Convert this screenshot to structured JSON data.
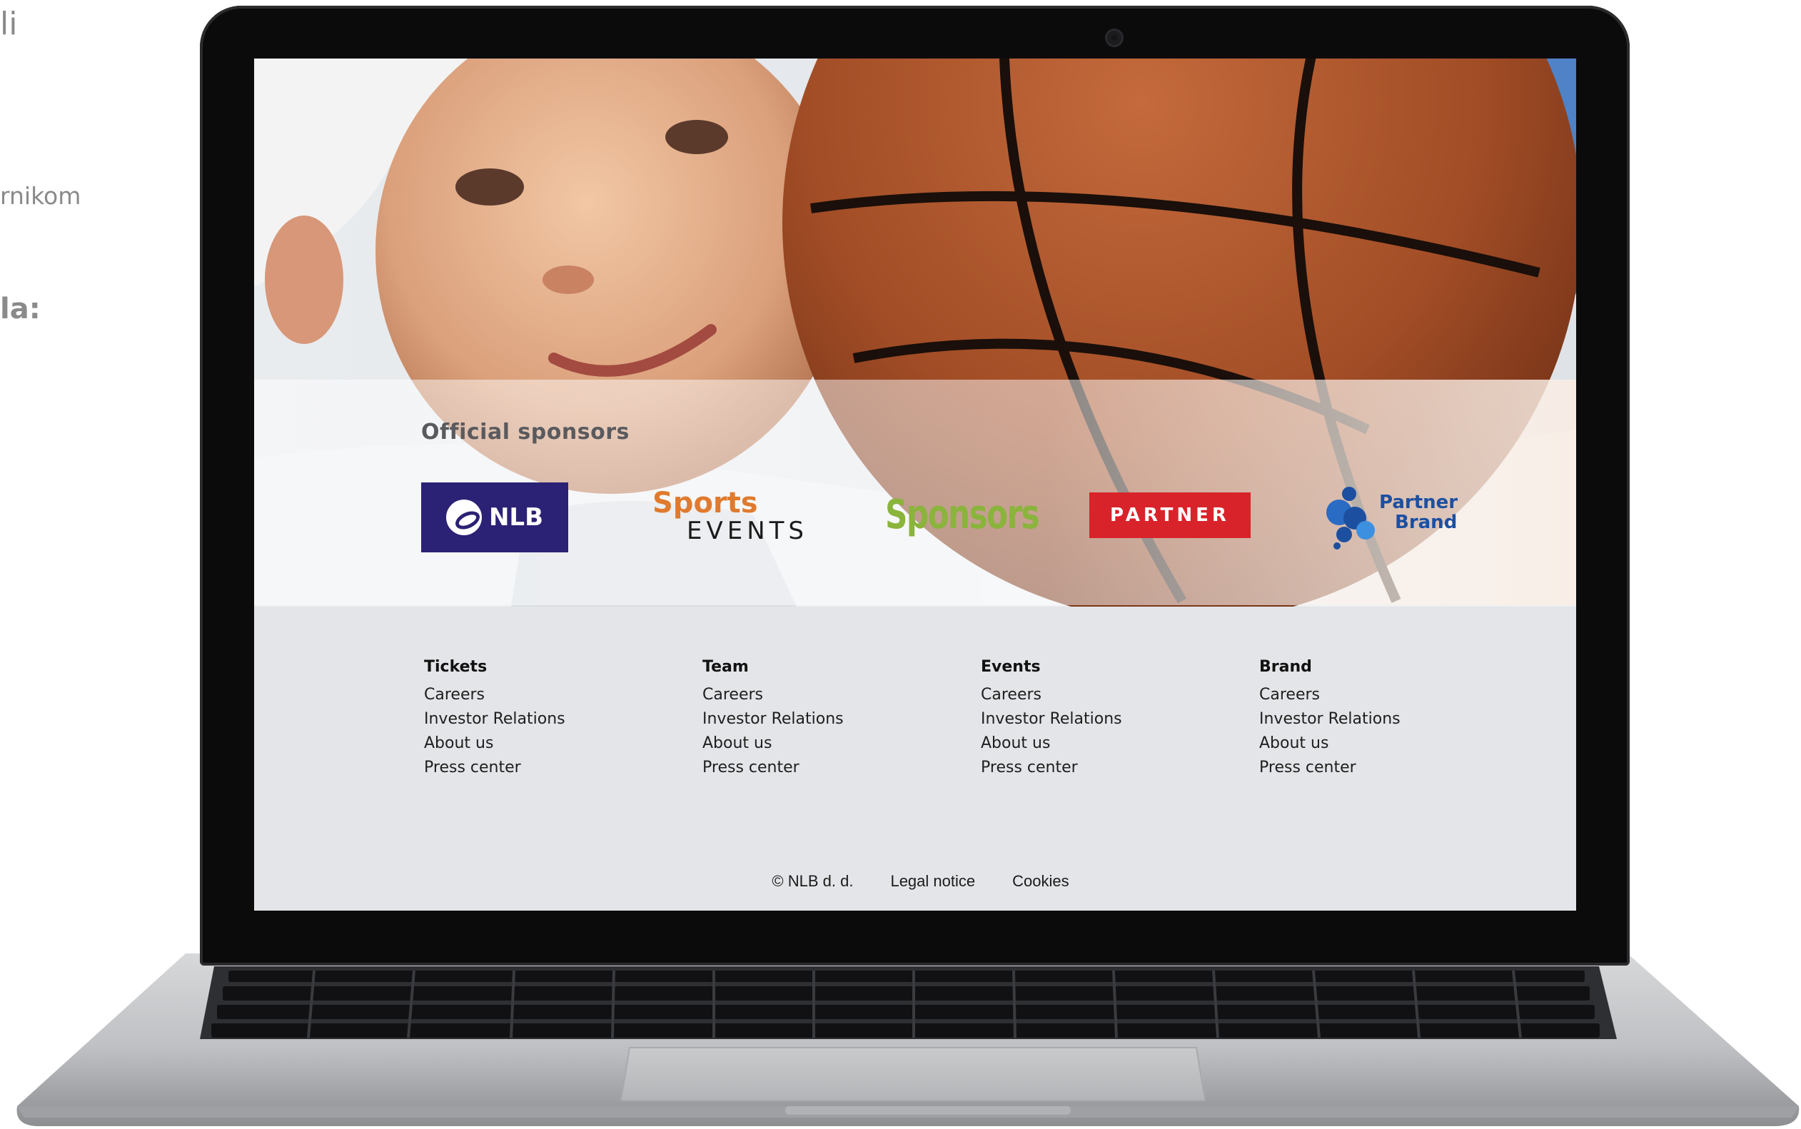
{
  "background_text": {
    "line1": "li",
    "line2": "rnikom",
    "line3": "la:"
  },
  "colors": {
    "nlb_purple": "#2b2275",
    "sports_orange": "#e07a2e",
    "sponsors_green": "#8ab43c",
    "partner_red": "#d9232a",
    "brand_blue": "#1d4fa0",
    "footer_bg": "#e4e5e8"
  },
  "hero": {
    "image": "kid-with-basketball-photo"
  },
  "sponsors": {
    "title": "Official sponsors",
    "logos": [
      {
        "name": "nlb-logo",
        "text": "NLB"
      },
      {
        "name": "sports-events-logo",
        "text_top": "Sports",
        "text_bottom": "EVENTS"
      },
      {
        "name": "sponsors-logo",
        "text": "Sponsors"
      },
      {
        "name": "partner-logo",
        "text": "PARTNER"
      },
      {
        "name": "partner-brand-logo",
        "text_top": "Partner",
        "text_bottom": "Brand"
      }
    ]
  },
  "footer": {
    "columns": [
      {
        "heading": "Tickets",
        "links": [
          "Careers",
          "Investor Relations",
          "About us",
          "Press center"
        ]
      },
      {
        "heading": "Team",
        "links": [
          "Careers",
          "Investor Relations",
          "About us",
          "Press center"
        ]
      },
      {
        "heading": "Events",
        "links": [
          "Careers",
          "Investor Relations",
          "About us",
          "Press center"
        ]
      },
      {
        "heading": "Brand",
        "links": [
          "Careers",
          "Investor Relations",
          "About us",
          "Press center"
        ]
      }
    ],
    "copyright": "© NLB d. d.",
    "legal_notice": "Legal notice",
    "cookies": "Cookies"
  }
}
